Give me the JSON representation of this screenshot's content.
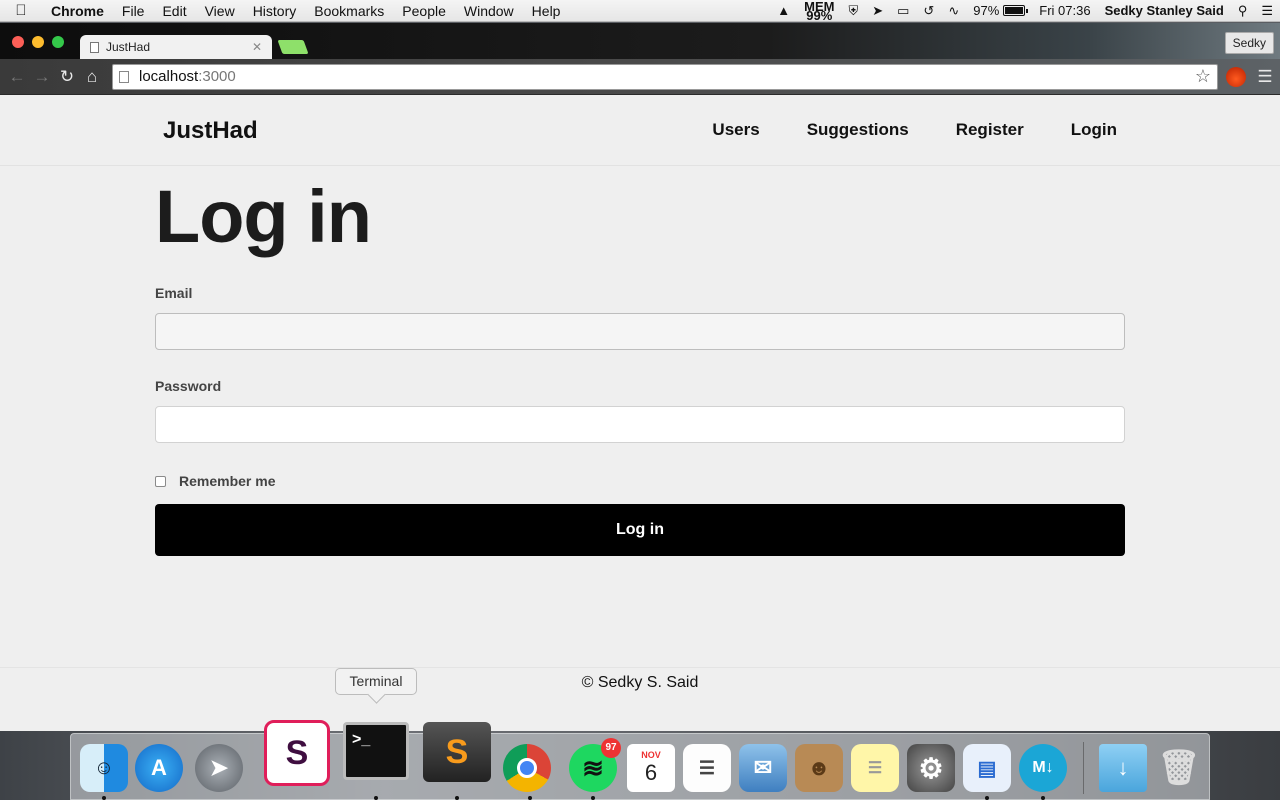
{
  "menubar": {
    "app": "Chrome",
    "items": [
      "File",
      "Edit",
      "View",
      "History",
      "Bookmarks",
      "People",
      "Window",
      "Help"
    ],
    "mem_label": "MEM",
    "mem_value": "99%",
    "battery": "97%",
    "clock": "Fri 07:36",
    "user": "Sedky Stanley Said"
  },
  "browser": {
    "tab_title": "JustHad",
    "profile": "Sedky",
    "url_host": "localhost",
    "url_port": ":3000"
  },
  "site": {
    "brand": "JustHad",
    "nav": [
      "Users",
      "Suggestions",
      "Register",
      "Login"
    ]
  },
  "form": {
    "heading": "Log in",
    "email_label": "Email",
    "password_label": "Password",
    "remember_label": "Remember me",
    "submit_label": "Log in"
  },
  "footer": {
    "text": "© Sedky S. Said"
  },
  "dock": {
    "tooltip": "Terminal",
    "spotify_badge": "97",
    "calendar_month": "NOV",
    "calendar_day": "6"
  }
}
